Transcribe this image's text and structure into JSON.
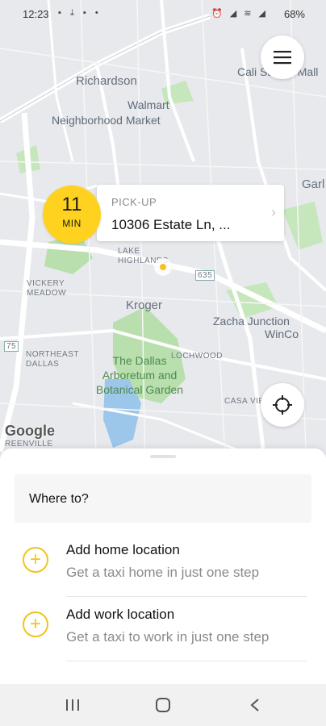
{
  "status_bar": {
    "time": "12:23",
    "left_icons": "▪ ⤓ ▪ •",
    "right_icons": "⏰ ◢ ≋ ◢",
    "battery": "68%"
  },
  "map": {
    "labels": {
      "richardson": "Richardson",
      "walmart": "Walmart",
      "neighborhood_market": "Neighborhood Market",
      "cali_mall": "Cali Sawan Mall",
      "garland": "Garl",
      "lake_highlands": "LAKE HIGHLANDS",
      "vickery_meadow": "VICKERY MEADOW",
      "kroger": "Kroger",
      "zacha_junction": "Zacha Junction",
      "winco": "WinCo",
      "northeast_dallas": "NORTHEAST DALLAS",
      "lochwood": "LOCHWOOD",
      "dallas_arboretum": "The Dallas Arboretum and Botanical Garden",
      "casa_view": "CASA VIE",
      "greenville": "REENVILLE",
      "hwy_635": "635",
      "hwy_75": "75"
    },
    "google_logo": "Google"
  },
  "pickup": {
    "eta_value": "11",
    "eta_unit": "MIN",
    "label": "PICK-UP",
    "address": "10306 Estate Ln, ..."
  },
  "sheet": {
    "search_placeholder": "Where to?",
    "items": [
      {
        "title": "Add home location",
        "subtitle": "Get a taxi home in just one step"
      },
      {
        "title": "Add work location",
        "subtitle": "Get a taxi to work in just one step"
      }
    ]
  },
  "colors": {
    "accent": "#f2c31b",
    "eta_badge": "#ffd21f",
    "map_bg": "#e8e9ec",
    "park_green": "#a9d79b",
    "water": "#9cc6ea"
  },
  "icons": {
    "menu": "hamburger-icon",
    "locate": "crosshair-icon",
    "add": "plus-circle-icon",
    "nav_recents": "recents-icon",
    "nav_home": "home-icon",
    "nav_back": "back-icon"
  }
}
